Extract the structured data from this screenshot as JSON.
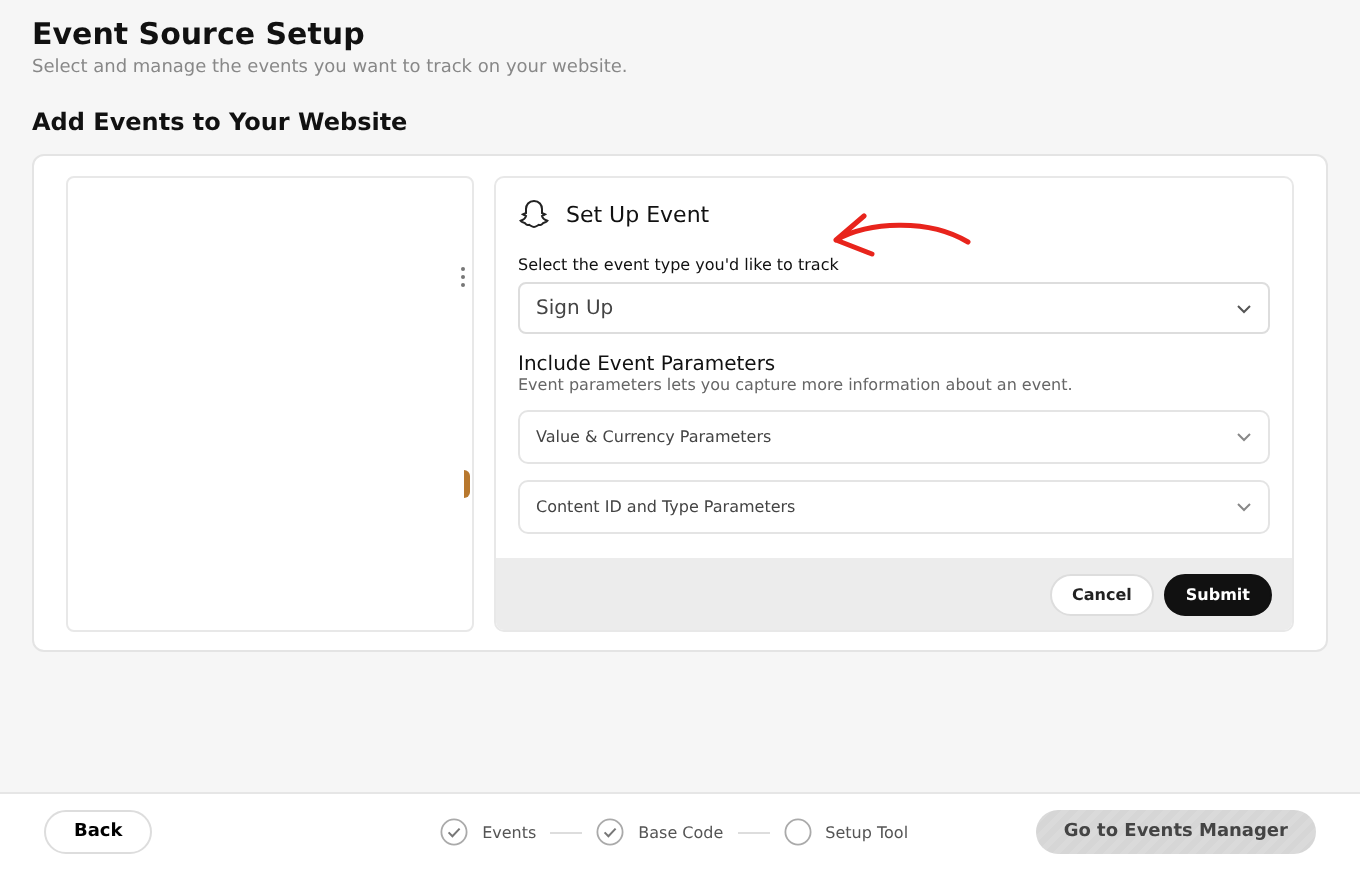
{
  "header": {
    "title": "Event Source Setup",
    "subtitle": "Select and manage the events you want to track on your website."
  },
  "section_title": "Add Events to Your Website",
  "setup": {
    "title": "Set Up Event",
    "event_type": {
      "label": "Select the event type you'd like to track",
      "value": "Sign Up"
    },
    "parameters": {
      "title": "Include Event Parameters",
      "description": "Event parameters lets you capture more information about an event.",
      "groups": [
        {
          "label": "Value & Currency Parameters",
          "expanded": false
        },
        {
          "label": "Content ID and Type Parameters",
          "expanded": false
        }
      ]
    },
    "buttons": {
      "cancel": "Cancel",
      "submit": "Submit"
    }
  },
  "footer": {
    "back": "Back",
    "steps": [
      {
        "label": "Events",
        "done": true
      },
      {
        "label": "Base Code",
        "done": true
      },
      {
        "label": "Setup Tool",
        "done": false
      }
    ],
    "next": {
      "label": "Go to Events Manager",
      "disabled": true
    }
  }
}
